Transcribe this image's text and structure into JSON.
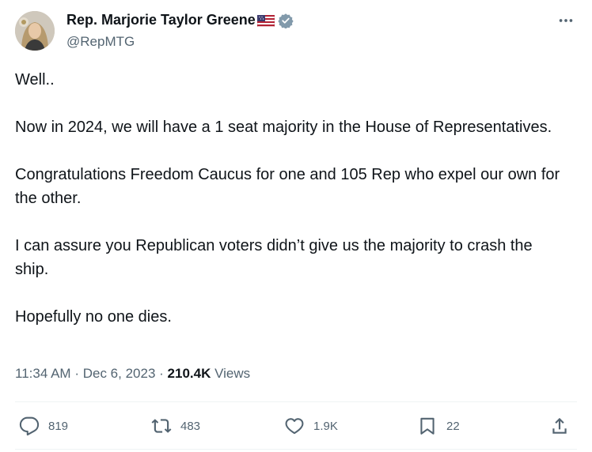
{
  "author": {
    "name": "Rep. Marjorie Taylor Greene",
    "handle": "@RepMTG"
  },
  "tweet": {
    "paragraphs": [
      "Well..",
      "Now in 2024, we will have a 1 seat majority in the House of Representatives.",
      "Congratulations Freedom Caucus for one and 105 Rep who expel our own for the other.",
      "I can assure you Republican voters didn’t give us the majority to crash the ship.",
      "Hopefully no one dies."
    ],
    "time": "11:34 AM",
    "separator": "·",
    "date": "Dec 6, 2023",
    "views_count": "210.4K",
    "views_label": "Views"
  },
  "actions": {
    "replies": "819",
    "reposts": "483",
    "likes": "1.9K",
    "bookmarks": "22"
  },
  "icons": {
    "more": "more-horizontal-icon",
    "reply": "reply-icon",
    "repost": "repost-icon",
    "like": "heart-icon",
    "bookmark": "bookmark-icon",
    "share": "share-icon",
    "verified": "verified-badge-icon",
    "flag": "us-flag-emoji"
  },
  "colors": {
    "text": "#0f1419",
    "secondary": "#536471",
    "verified": "#829aab"
  }
}
